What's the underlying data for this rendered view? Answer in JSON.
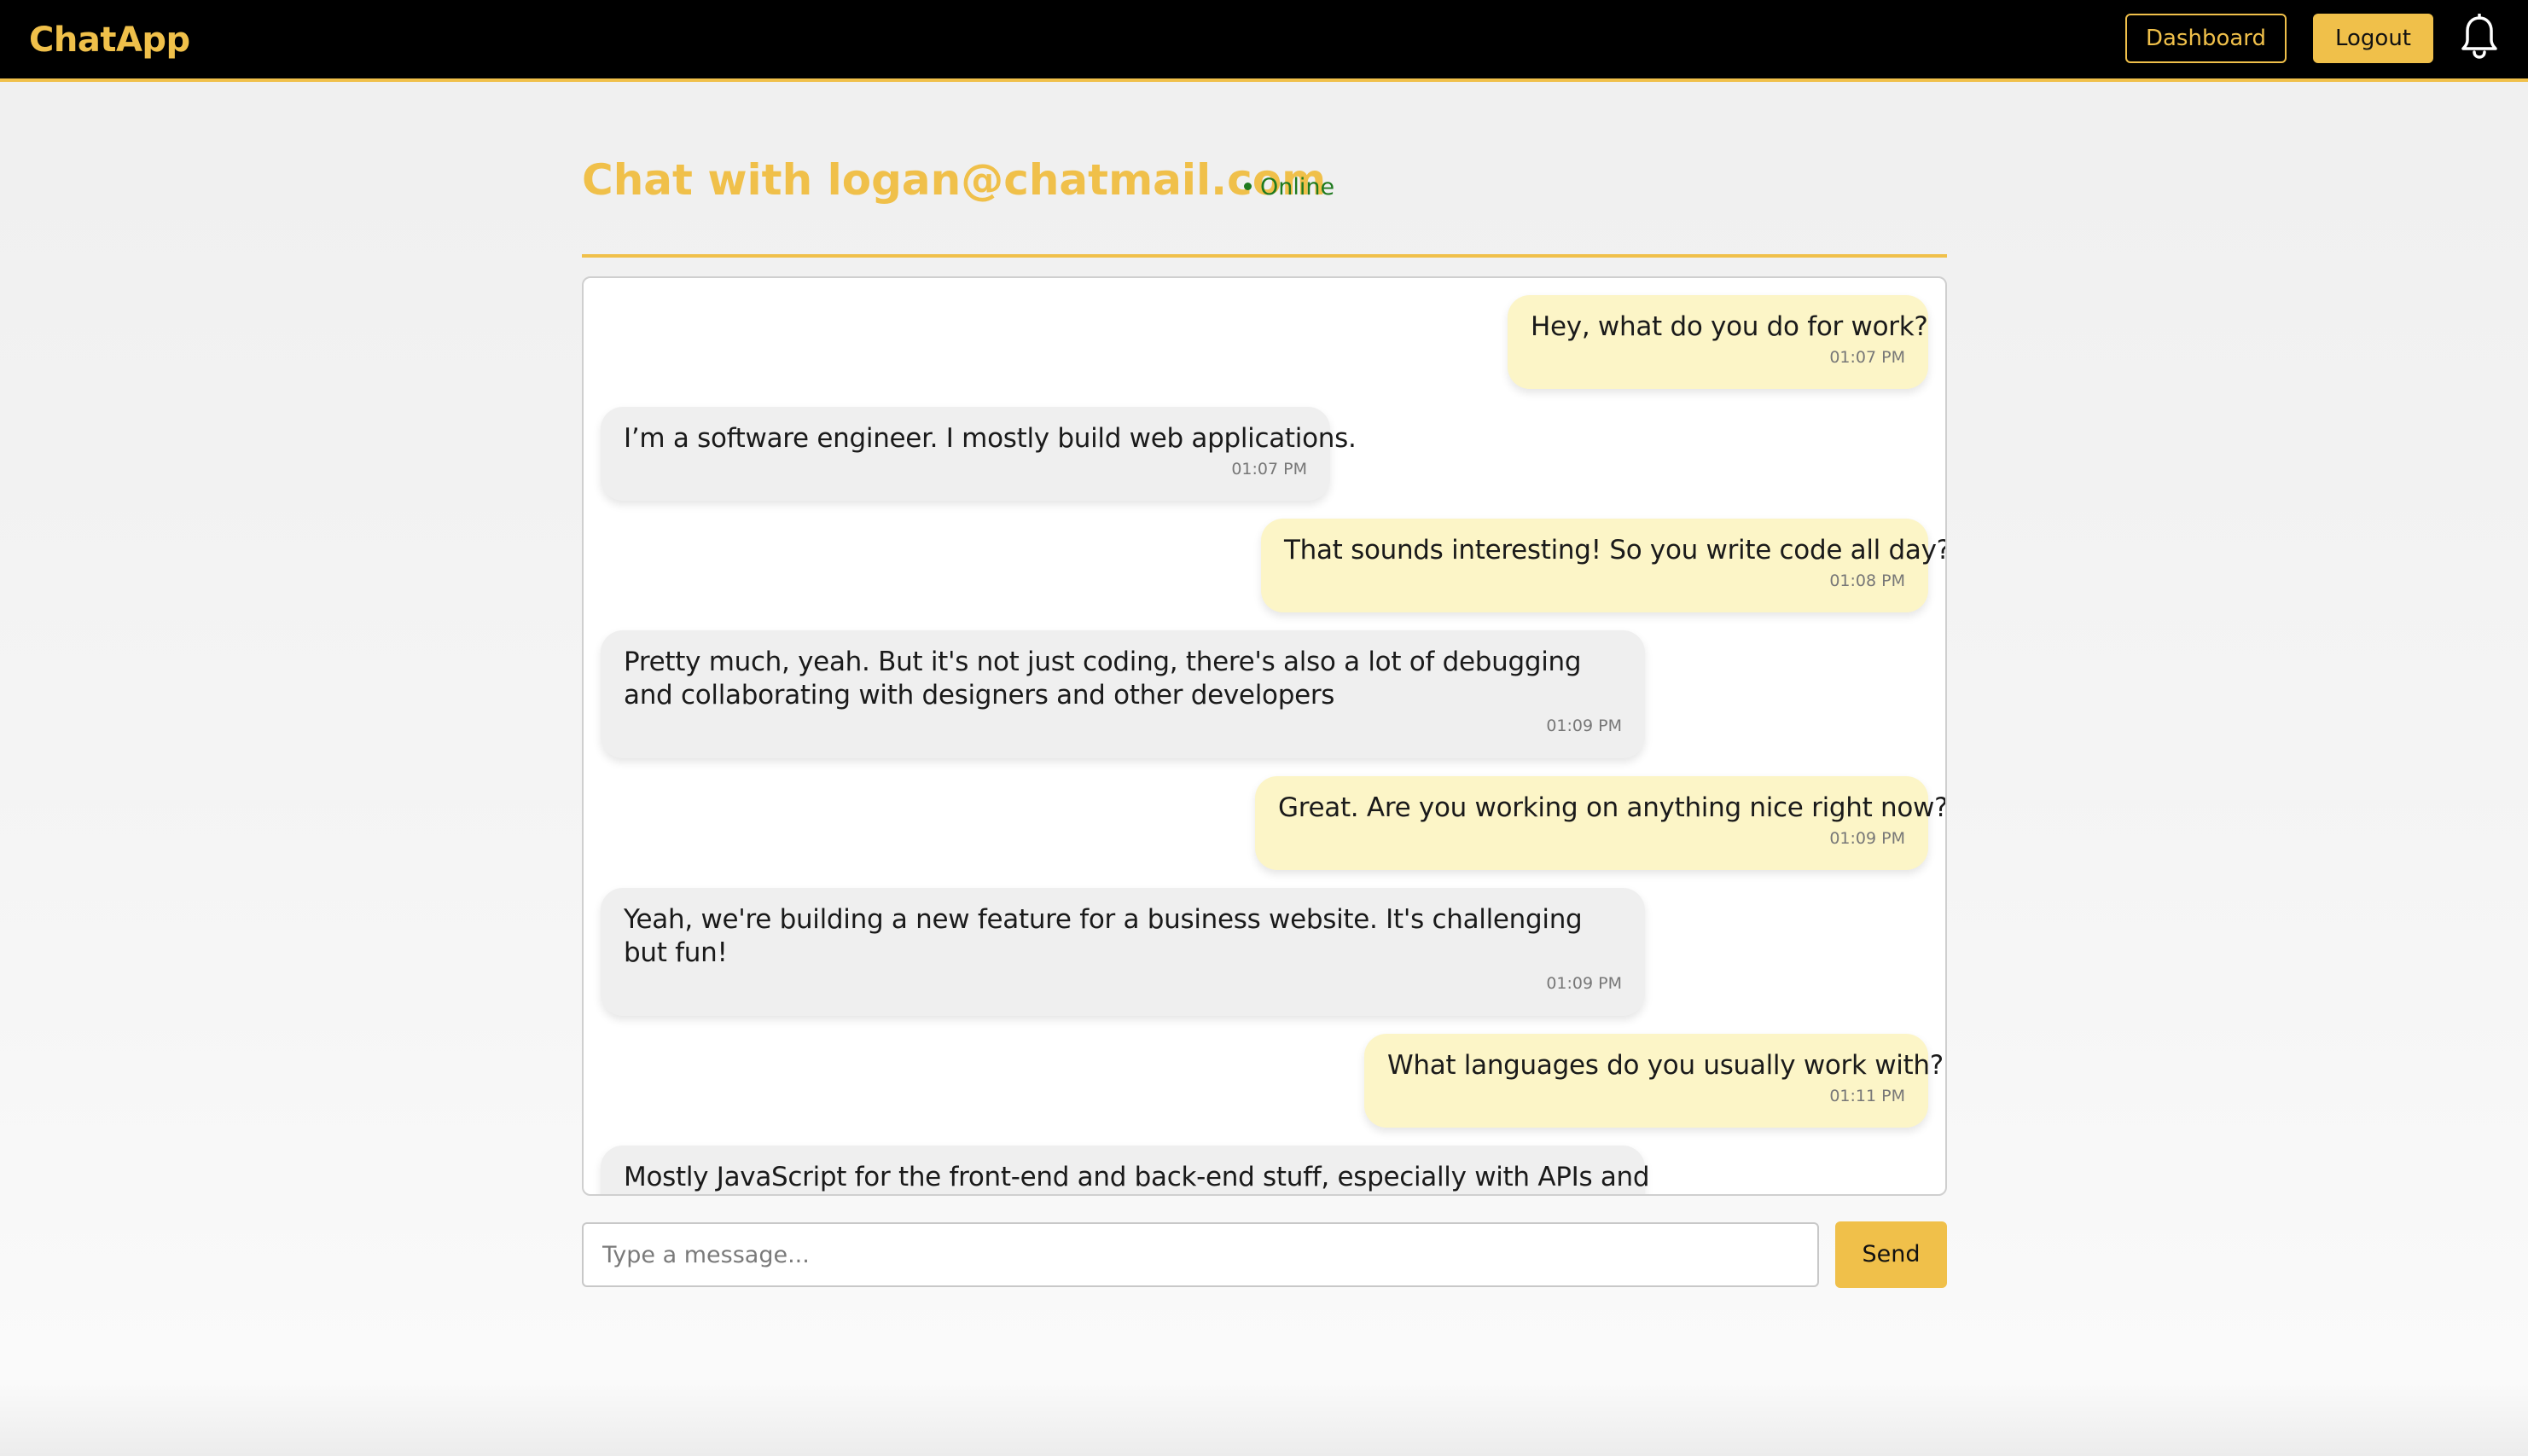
{
  "navbar": {
    "brand": "ChatApp",
    "dashboard_label": "Dashboard",
    "logout_label": "Logout",
    "notification_icon": "bell-icon"
  },
  "chat": {
    "title": "Chat with logan@chatmail.com",
    "status": "Online",
    "status_color": "#1f7a1f",
    "messages": [
      {
        "from": "me",
        "text": "Hey, what do you do for work?",
        "time": "01:07 PM"
      },
      {
        "from": "them",
        "text": "I’m a software engineer. I mostly build web applications.",
        "time": "01:07 PM"
      },
      {
        "from": "me",
        "text": "That sounds interesting! So you write code all day?",
        "time": "01:08 PM"
      },
      {
        "from": "them",
        "text": "Pretty much, yeah. But it's not just coding, there's also a lot of debugging and collaborating with designers and other developers",
        "time": "01:09 PM"
      },
      {
        "from": "me",
        "text": "Great. Are you working on anything nice right now?",
        "time": "01:09 PM"
      },
      {
        "from": "them",
        "text": "Yeah, we're building a new feature for a business website. It's challenging but fun!",
        "time": "01:09 PM"
      },
      {
        "from": "me",
        "text": "What languages do you usually work with?",
        "time": "01:11 PM"
      },
      {
        "from": "them",
        "text": "Mostly JavaScript for the front-end and back-end stuff, especially with APIs and",
        "time": ""
      }
    ]
  },
  "composer": {
    "placeholder": "Type a message...",
    "value": "",
    "send_label": "Send"
  },
  "colors": {
    "accent": "#f0c04a",
    "navbar_bg": "#000000",
    "sent_bubble": "#fcf5c7",
    "received_bubble": "#efefef"
  }
}
